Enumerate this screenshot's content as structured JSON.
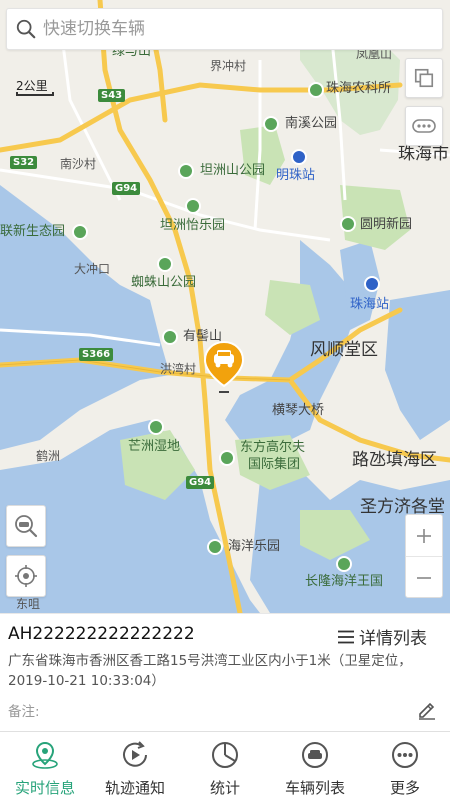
{
  "search": {
    "placeholder": "快速切换车辆"
  },
  "map": {
    "scale_label": "2公里",
    "labels": {
      "jiechong": "界冲村",
      "fenghuang": "凤凰山",
      "zhuhai_agri": "珠海农科所",
      "nanxi": "南溪公园",
      "zhuhai_city": "珠海市",
      "mingzhu_station": "明珠站",
      "nansha": "南沙村",
      "tanzhou_park": "坦洲山公园",
      "tanzhou_yi": "坦洲怡乐园",
      "yuanming": "圆明新园",
      "ecology": "联新生态园",
      "dachongkou": "大冲口",
      "zhizhu": "蜘蛛山公园",
      "zhuhai_station": "珠海站",
      "youji": "有髻山",
      "fengshun": "风顺堂区",
      "hongwan": "洪湾村",
      "hengqin_bridge": "横琴大桥",
      "mangzhou": "芒洲湿地",
      "dongfang": "东方高尔夫",
      "dongfang2": "国际集团",
      "luhuan": "路氹填海区",
      "hezhou": "鹤洲",
      "shengfang": "圣方济各堂",
      "haiyang": "海洋乐园",
      "changlong": "长隆海洋王国",
      "dongxian": "东咀",
      "liuhua": "绿与山"
    },
    "shields": {
      "s43": "S43",
      "s32": "S32",
      "g94a": "G94",
      "s366": "S366",
      "g94b": "G94"
    }
  },
  "vehicle": {
    "plate": "AH222222222222222",
    "detail_label": "详情列表",
    "address": "广东省珠海市香洲区香工路15号洪湾工业区内小于1米（卫星定位，2019-10-21 10:33:04）",
    "remark_label": "备注:"
  },
  "tabs": [
    {
      "label": "实时信息",
      "icon": "location-realtime-icon",
      "active": true
    },
    {
      "label": "轨迹通知",
      "icon": "track-play-icon",
      "active": false
    },
    {
      "label": "统计",
      "icon": "statistics-icon",
      "active": false
    },
    {
      "label": "车辆列表",
      "icon": "vehicle-list-icon",
      "active": false
    },
    {
      "label": "更多",
      "icon": "more-icon",
      "active": false
    }
  ],
  "colors": {
    "accent": "#27a37a",
    "marker": "#f2a20d",
    "water": "#a9c7e8",
    "road_major": "#f7c94e",
    "park": "#c9e3b5"
  }
}
